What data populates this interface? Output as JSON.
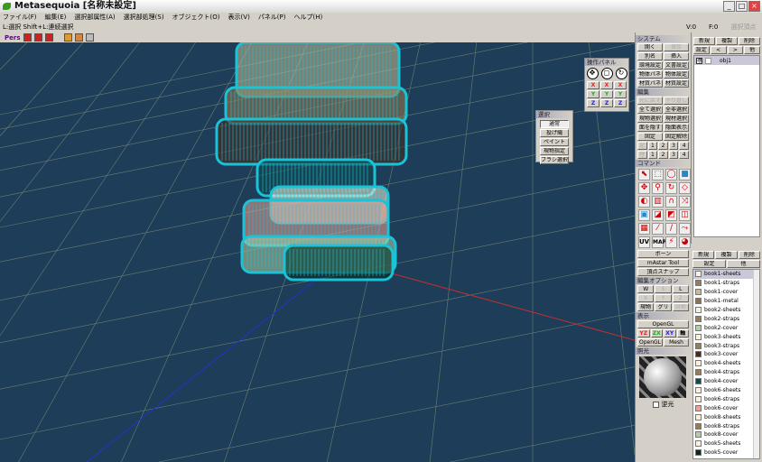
{
  "title": "Metasequoia [名称未設定]",
  "menu": [
    "ファイル(F)",
    "編集(E)",
    "選択部属性(A)",
    "選択部処理(S)",
    "オブジェクト(O)",
    "表示(V)",
    "パネル(P)",
    "ヘルプ(H)"
  ],
  "status": "L:選択  Shift+L:連続選択",
  "counters": {
    "v": "V:0",
    "f": "F:0",
    "extra": "選択頂点"
  },
  "toolbar": {
    "view_mode": "Pers"
  },
  "op_panel": {
    "title": "操作パネル",
    "axes": [
      "X",
      "X",
      "X",
      "Y",
      "Y",
      "Y",
      "Z",
      "Z",
      "Z"
    ]
  },
  "select_panel": {
    "title": "選択",
    "buttons": [
      "通常",
      "投げ縄",
      "ペイント",
      "現物指定",
      "ブラシ選択"
    ]
  },
  "system": {
    "title": "システム",
    "rows": [
      [
        "開く",
        "保存"
      ],
      [
        "別名",
        "挿入"
      ],
      [
        "環境設定",
        "文書設定"
      ],
      [
        "物体パネル",
        "物体設定"
      ],
      [
        "材質パネル",
        "材質設定"
      ]
    ]
  },
  "edit": {
    "title": "編集",
    "rows": [
      [
        "元に戻す",
        "やり直し"
      ],
      [
        "全て選択",
        "全非選択"
      ],
      [
        "現物選択",
        "現材選択"
      ],
      [
        "面を隠す",
        "隠面表示"
      ],
      [
        "固定",
        "固定解除"
      ]
    ],
    "memory": [
      "記憶",
      "呼出"
    ],
    "slots": [
      "1",
      "2",
      "3",
      "4"
    ]
  },
  "command": {
    "title": "コマンド",
    "icons": [
      "select-arrow",
      "rect-select",
      "lasso",
      "box",
      "move",
      "zoom",
      "rotate",
      "bevel",
      "knife",
      "edge",
      "magnet",
      "bridge",
      "extrude",
      "face",
      "paint",
      "mirror",
      "wire",
      "curve",
      "pen",
      "sweep",
      "uv",
      "mapping",
      "wand",
      "palette"
    ],
    "uv": "UV",
    "map": "MAP",
    "buttons": [
      "ボーン",
      "mAstar Tool",
      "頂点スナップ"
    ]
  },
  "edit_option": {
    "title": "編集オプション",
    "buttons": [
      "W",
      "S",
      "L",
      "X",
      "Y",
      "Z",
      "現物",
      "グリッド",
      "対称"
    ]
  },
  "display": {
    "title": "表示",
    "opengl": "OpenGL",
    "yz": "YZ",
    "zx": "ZX",
    "xy": "XY",
    "axis": "軸",
    "opengl2": "OpenGL",
    "mesh": "Mesh"
  },
  "light": {
    "title": "照光",
    "checkbox": "逆光",
    "checked": false
  },
  "object_panel": {
    "buttons": [
      "新規",
      "複製",
      "削除",
      "設定",
      "<",
      ">",
      "他"
    ],
    "items": [
      {
        "name": "obj1",
        "visible": true
      }
    ]
  },
  "material_panel": {
    "buttons": [
      "新規",
      "複製",
      "削除",
      "設定",
      "他"
    ],
    "materials": [
      {
        "name": "book1-sheets",
        "color": "#fdf0d8"
      },
      {
        "name": "book1-straps",
        "color": "#9a7c4e"
      },
      {
        "name": "book1-cover",
        "color": "#c9b98e"
      },
      {
        "name": "book1-metal",
        "color": "#8f7448"
      },
      {
        "name": "book2-sheets",
        "color": "#fdf0d8"
      },
      {
        "name": "book2-straps",
        "color": "#9a7c4e"
      },
      {
        "name": "book2-cover",
        "color": "#b0d0a0"
      },
      {
        "name": "book3-sheets",
        "color": "#fdf0d8"
      },
      {
        "name": "book3-straps",
        "color": "#9a7c4e"
      },
      {
        "name": "book3-cover",
        "color": "#4a2a1a"
      },
      {
        "name": "book4-sheets",
        "color": "#fdf0d8"
      },
      {
        "name": "book4-straps",
        "color": "#9a7c4e"
      },
      {
        "name": "book4-cover",
        "color": "#0e4a50"
      },
      {
        "name": "book6-sheets",
        "color": "#fdf0d8"
      },
      {
        "name": "book6-straps",
        "color": "#fdf0d8"
      },
      {
        "name": "book6-cover",
        "color": "#f0a090"
      },
      {
        "name": "book8-sheets",
        "color": "#fdf0d8"
      },
      {
        "name": "book8-straps",
        "color": "#9a7c4e"
      },
      {
        "name": "book8-cover",
        "color": "#b0d0a0"
      },
      {
        "name": "book5-sheets",
        "color": "#fdf0d8"
      },
      {
        "name": "book5-cover",
        "color": "#0a2a1a"
      }
    ]
  }
}
